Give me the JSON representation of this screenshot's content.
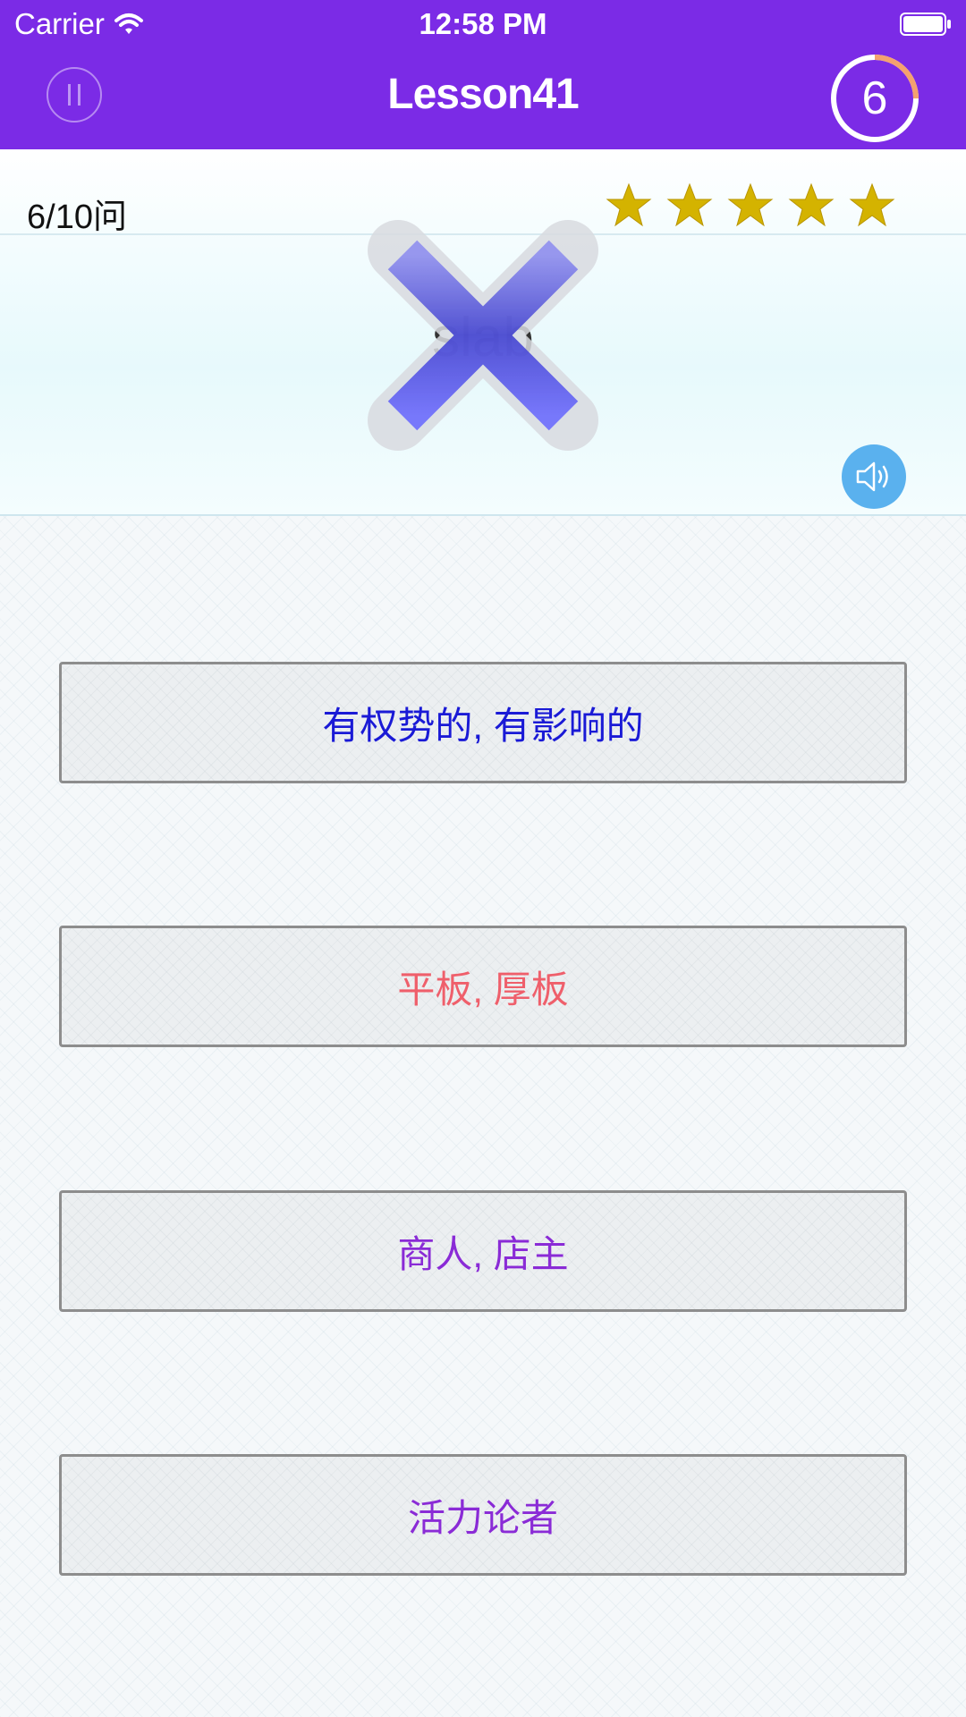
{
  "status_bar": {
    "carrier": "Carrier",
    "time": "12:58 PM",
    "icons": [
      "wifi-icon",
      "battery-icon"
    ]
  },
  "nav": {
    "title": "Lesson41",
    "pause_icon": "pause-icon",
    "timer_value": "6",
    "timer_progress": 0.25
  },
  "question": {
    "progress": "6/10问",
    "stars_filled": 5,
    "stars_total": 5,
    "word": "slab",
    "result_icon": "wrong-x-icon",
    "speaker_icon": "speaker-icon"
  },
  "answers": [
    {
      "label": "有权势的, 有影响的"
    },
    {
      "label": "平板, 厚板"
    },
    {
      "label": "商人, 店主"
    },
    {
      "label": "活力论者"
    }
  ],
  "colors": {
    "nav_bg": "#7b2be6",
    "timer_arc": "#f4a16f",
    "star": "#d4b300",
    "speaker_bg": "#5ab1ee",
    "answer_1": "#1a1ad6",
    "answer_2": "#ef5f6b",
    "answer_3": "#8a2bd6",
    "answer_4": "#8a2bd6"
  }
}
